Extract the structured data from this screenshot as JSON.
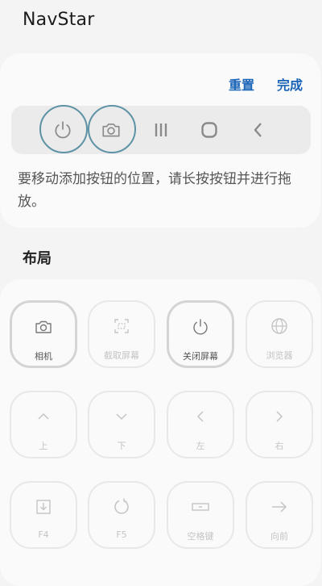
{
  "app": {
    "title": "NavStar"
  },
  "editor": {
    "reset_label": "重置",
    "done_label": "完成",
    "hint": "要移动添加按钮的位置，请长按按钮并进行拖放。"
  },
  "navbar_preview": {
    "buttons": [
      {
        "icon": "power-icon",
        "added": true
      },
      {
        "icon": "camera-icon",
        "added": true
      },
      {
        "icon": "recents-icon",
        "added": false
      },
      {
        "icon": "home-icon",
        "added": false
      },
      {
        "icon": "back-icon",
        "added": false
      }
    ]
  },
  "layout": {
    "title": "布局",
    "tiles": [
      {
        "label": "相机",
        "icon": "camera-icon",
        "active": true
      },
      {
        "label": "截取屏幕",
        "icon": "screenshot-icon",
        "active": false
      },
      {
        "label": "关闭屏幕",
        "icon": "power-icon",
        "active": true
      },
      {
        "label": "浏览器",
        "icon": "globe-icon",
        "active": false
      },
      {
        "label": "上",
        "icon": "arrow-up-icon",
        "active": false
      },
      {
        "label": "下",
        "icon": "arrow-down-icon",
        "active": false
      },
      {
        "label": "左",
        "icon": "arrow-left-icon",
        "active": false
      },
      {
        "label": "右",
        "icon": "arrow-right-icon",
        "active": false
      },
      {
        "label": "F4",
        "icon": "f4-icon",
        "active": false
      },
      {
        "label": "F5",
        "icon": "refresh-icon",
        "active": false
      },
      {
        "label": "空格键",
        "icon": "space-icon",
        "active": false
      },
      {
        "label": "向前",
        "icon": "forward-arrow-icon",
        "active": false
      }
    ]
  },
  "colors": {
    "accent": "#1a64b8",
    "highlight_ring": "#5e93a5",
    "background": "#f4f4f4",
    "card": "#fafafa"
  }
}
